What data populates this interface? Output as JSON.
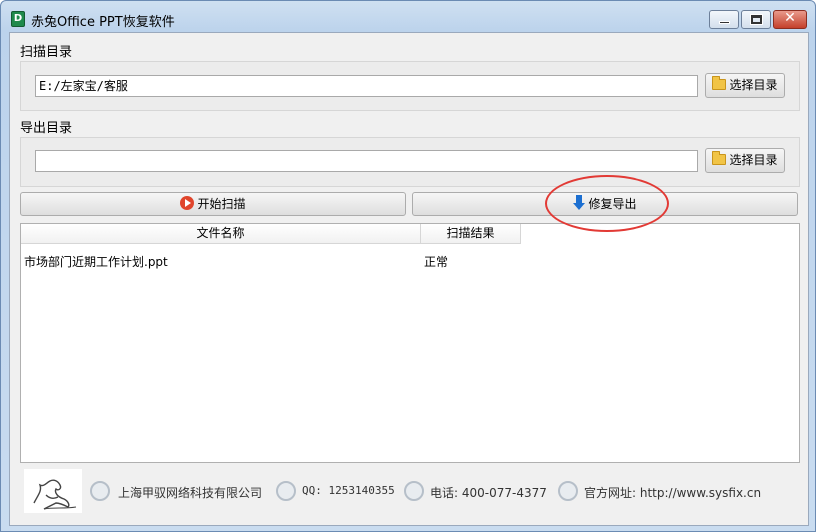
{
  "window": {
    "title": "赤兔Office PPT恢复软件",
    "close_glyph": "✕"
  },
  "scan_dir": {
    "label": "扫描目录",
    "value": "E:/左家宝/客服",
    "button_label": "选择目录"
  },
  "export_dir": {
    "label": "导出目录",
    "value": "",
    "button_label": "选择目录"
  },
  "actions": {
    "start_scan_label": "开始扫描",
    "repair_export_label": "修复导出"
  },
  "table": {
    "headers": [
      "文件名称",
      "扫描结果"
    ],
    "rows": [
      {
        "filename": "市场部门近期工作计划.ppt",
        "result": "正常"
      }
    ]
  },
  "footer": {
    "company": "上海甲驭网络科技有限公司",
    "qq": "QQ: 1253140355",
    "phone": "电话: 400-077-4377",
    "website": "官方网址: http://www.sysfix.cn"
  },
  "colors": {
    "highlight_ellipse": "#e23a35",
    "accent_blue": "#1c6fd1"
  }
}
